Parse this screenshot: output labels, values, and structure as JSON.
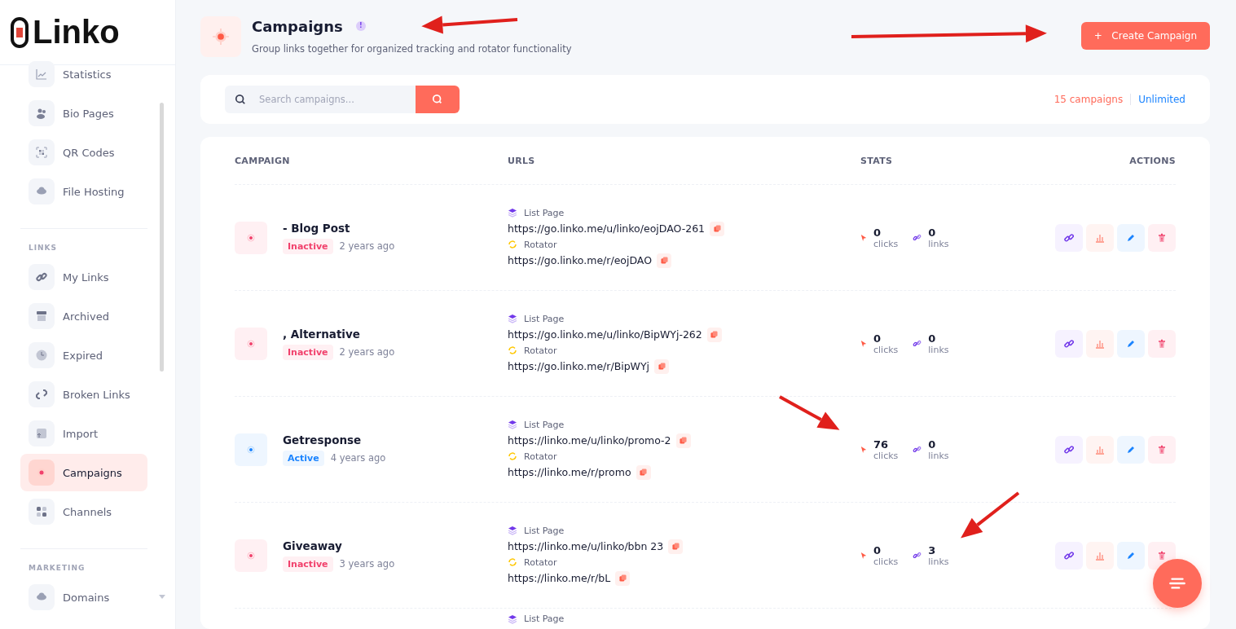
{
  "sidebar": {
    "logo": "Linko",
    "sections": [
      {
        "items": [
          {
            "label": "Statistics",
            "selected": false
          },
          {
            "label": "Bio Pages",
            "selected": false
          },
          {
            "label": "QR Codes",
            "selected": false
          },
          {
            "label": "File Hosting",
            "selected": false
          }
        ]
      },
      {
        "title": "LINKS",
        "items": [
          {
            "label": "My Links",
            "selected": false
          },
          {
            "label": "Archived",
            "selected": false
          },
          {
            "label": "Expired",
            "selected": false
          },
          {
            "label": "Broken Links",
            "selected": false
          },
          {
            "label": "Import",
            "selected": false
          },
          {
            "label": "Campaigns",
            "selected": true
          },
          {
            "label": "Channels",
            "selected": false
          }
        ]
      },
      {
        "title": "MARKETING",
        "items": [
          {
            "label": "Domains",
            "selected": false,
            "expandable": true
          }
        ]
      }
    ]
  },
  "header": {
    "title": "Campaigns",
    "info_badge": "!",
    "subtitle": "Group links together for organized tracking and rotator functionality",
    "create_button": "Create Campaign",
    "create_icon": "+"
  },
  "search": {
    "placeholder": "Search campaigns...",
    "count": "15 campaigns",
    "plan": "Unlimited"
  },
  "table": {
    "columns": [
      "CAMPAIGN",
      "URLS",
      "STATS",
      "ACTIONS"
    ],
    "rows": [
      {
        "name": "- Blog Post",
        "status": "Inactive",
        "active": false,
        "age": "2 years ago",
        "list_label": "List Page",
        "list_url": "https://go.linko.me/u/linko/eojDAO-261",
        "rotator_label": "Rotator",
        "rotator_url": "https://go.linko.me/r/eojDAO",
        "clicks": "0",
        "clicks_label": "clicks",
        "links": "0",
        "links_label": "links"
      },
      {
        "name": ", Alternative",
        "status": "Inactive",
        "active": false,
        "age": "2 years ago",
        "list_label": "List Page",
        "list_url": "https://go.linko.me/u/linko/BipWYj-262",
        "rotator_label": "Rotator",
        "rotator_url": "https://go.linko.me/r/BipWYj",
        "clicks": "0",
        "clicks_label": "clicks",
        "links": "0",
        "links_label": "links"
      },
      {
        "name": "Getresponse",
        "status": "Active",
        "active": true,
        "age": "4 years ago",
        "list_label": "List Page",
        "list_url": "https://linko.me/u/linko/promo-2",
        "rotator_label": "Rotator",
        "rotator_url": "https://linko.me/r/promo",
        "clicks": "76",
        "clicks_label": "clicks",
        "links": "0",
        "links_label": "links"
      },
      {
        "name": "Giveaway",
        "status": "Inactive",
        "active": false,
        "age": "3 years ago",
        "list_label": "List Page",
        "list_url": "https://linko.me/u/linko/bbn 23",
        "rotator_label": "Rotator",
        "rotator_url": "https://linko.me/r/bL",
        "clicks": "0",
        "clicks_label": "clicks",
        "links": "3",
        "links_label": "links"
      },
      {
        "list_label": "List Page"
      }
    ]
  },
  "annotation_arrows": [
    {
      "kind": "arrow"
    },
    {
      "kind": "arrow"
    },
    {
      "kind": "arrow"
    },
    {
      "kind": "arrow"
    }
  ]
}
